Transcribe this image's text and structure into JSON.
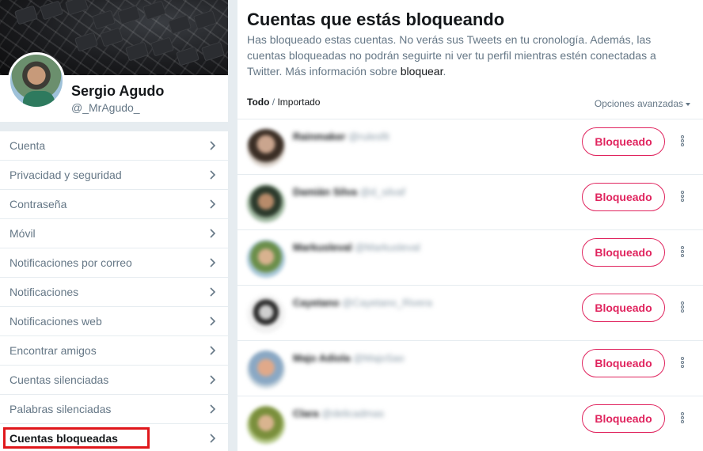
{
  "profile": {
    "name": "Sergio Agudo",
    "handle": "@_MrAgudo_"
  },
  "menu": {
    "items": [
      {
        "label": "Cuenta"
      },
      {
        "label": "Privacidad y seguridad"
      },
      {
        "label": "Contraseña"
      },
      {
        "label": "Móvil"
      },
      {
        "label": "Notificaciones por correo"
      },
      {
        "label": "Notificaciones"
      },
      {
        "label": "Notificaciones web"
      },
      {
        "label": "Encontrar amigos"
      },
      {
        "label": "Cuentas silenciadas"
      },
      {
        "label": "Palabras silenciadas"
      },
      {
        "label": "Cuentas bloqueadas"
      }
    ],
    "active_index": 10
  },
  "main": {
    "title": "Cuentas que estás bloqueando",
    "description": "Has bloqueado estas cuentas. No verás sus Tweets en tu cronología. Además, las cuentas bloqueadas no podrán seguirte ni ver tu perfil mientras estén conectadas a Twitter. Más información sobre ",
    "description_link": "bloquear",
    "description_end": ".",
    "filter_all": "Todo",
    "filter_separator": " / ",
    "filter_imported": "Importado",
    "advanced_options": "Opciones avanzadas"
  },
  "blocked_accounts": [
    {
      "name": "Rainmaker",
      "handle": "@rulesfit",
      "button": "Bloqueado"
    },
    {
      "name": "Damián Silva",
      "handle": "@d_silvaf",
      "button": "Bloqueado"
    },
    {
      "name": "Markusleval",
      "handle": "@Markusleval",
      "button": "Bloqueado"
    },
    {
      "name": "Cayetano",
      "handle": "@Cayetano_Rivera",
      "button": "Bloqueado"
    },
    {
      "name": "Majo Adiola",
      "handle": "@MajoSao",
      "button": "Bloqueado"
    },
    {
      "name": "Clara",
      "handle": "@delicadmas",
      "button": "Bloqueado"
    }
  ],
  "colors": {
    "accent_red": "#e0245e",
    "highlight_box": "#e0171b",
    "muted_text": "#657786",
    "background": "#e6ecf0"
  }
}
